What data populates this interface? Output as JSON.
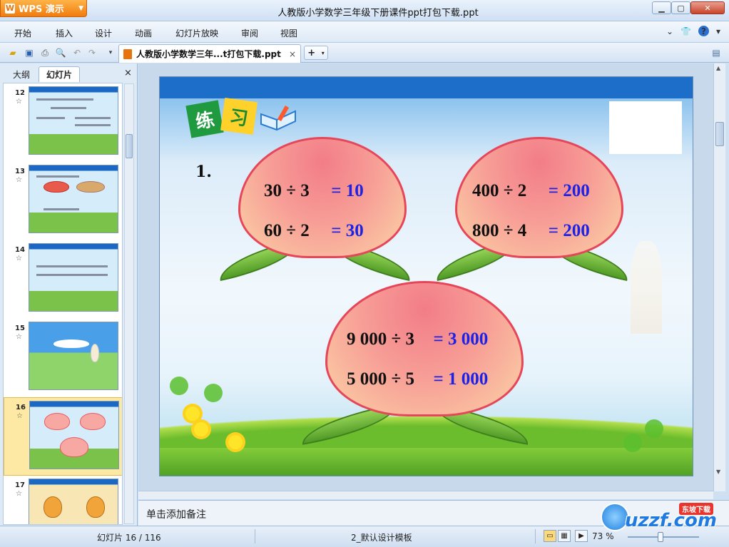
{
  "app": {
    "name": "WPS 演示",
    "window_title": "人教版小学数学三年级下册课件ppt打包下载.ppt"
  },
  "menu": {
    "items": [
      "开始",
      "插入",
      "设计",
      "动画",
      "幻灯片放映",
      "审阅",
      "视图"
    ]
  },
  "toolbar": {
    "doc_tab_label": "人教版小学数学三年...t打包下载.ppt",
    "close_glyph": "×",
    "new_tab_glyph": "+"
  },
  "left_panel": {
    "tabs": [
      "大纲",
      "幻灯片"
    ],
    "close_glyph": "×",
    "slides": [
      {
        "num": "12",
        "star": "☆"
      },
      {
        "num": "13",
        "star": "☆"
      },
      {
        "num": "14",
        "star": "☆"
      },
      {
        "num": "15",
        "star": "☆"
      },
      {
        "num": "16",
        "star": "☆"
      },
      {
        "num": "17",
        "star": "☆"
      }
    ],
    "selected_index": 4
  },
  "slide": {
    "badge_chars": [
      "练",
      "习"
    ],
    "problem_number": "1.",
    "peaches": [
      {
        "lines": [
          {
            "q": "30 ÷ 3",
            "a": "= 10"
          },
          {
            "q": "60 ÷ 2",
            "a": "= 30"
          }
        ]
      },
      {
        "lines": [
          {
            "q": "400 ÷ 2",
            "a": "= 200"
          },
          {
            "q": "800 ÷ 4",
            "a": "= 200"
          }
        ]
      },
      {
        "lines": [
          {
            "q": "9 000 ÷ 3",
            "a": "= 3 000"
          },
          {
            "q": "5 000 ÷ 5",
            "a": "= 1 000"
          }
        ]
      }
    ]
  },
  "notes": {
    "placeholder": "单击添加备注"
  },
  "status": {
    "slide_info": "幻灯片 16 / 116",
    "template": "2_默认设计模板",
    "zoom": "73 %"
  },
  "watermark": {
    "text": "uzzf.com",
    "tag": "东坡下载"
  },
  "colors": {
    "answer": "#1c22e6",
    "accent_orange": "#f07c10",
    "peach_border": "#e5465a"
  }
}
